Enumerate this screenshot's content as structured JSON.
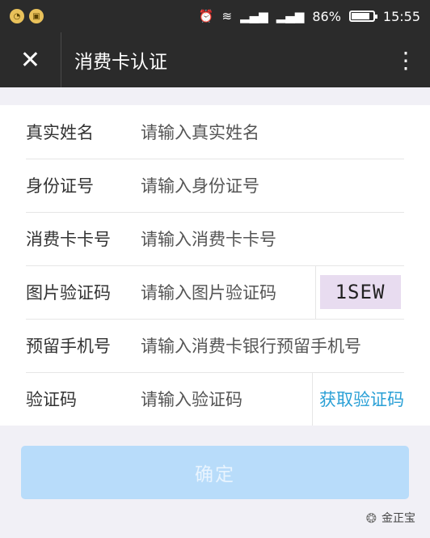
{
  "statusbar": {
    "app_icon_1": "wechat-icon",
    "app_icon_2": "notification-icon",
    "battery_percent": "86%",
    "battery_level": 0.86,
    "time": "15:55"
  },
  "titlebar": {
    "title": "消费卡认证",
    "close_icon": "✕",
    "more_icon": "⋮"
  },
  "form": {
    "rows": [
      {
        "label": "真实姓名",
        "placeholder": "请输入真实姓名"
      },
      {
        "label": "身份证号",
        "placeholder": "请输入身份证号"
      },
      {
        "label": "消费卡卡号",
        "placeholder": "请输入消费卡卡号"
      },
      {
        "label": "图片验证码",
        "placeholder": "请输入图片验证码",
        "captcha": "1SEW"
      },
      {
        "label": "预留手机号",
        "placeholder": "请输入消费卡银行预留手机号"
      },
      {
        "label": "验证码",
        "placeholder": "请输入验证码",
        "action": "获取验证码"
      }
    ]
  },
  "confirm_label": "确定",
  "watermark": "金正宝",
  "colors": {
    "header": "#2b2b2b",
    "link": "#2aa0d6",
    "button_disabled": "#b8dcfa"
  }
}
